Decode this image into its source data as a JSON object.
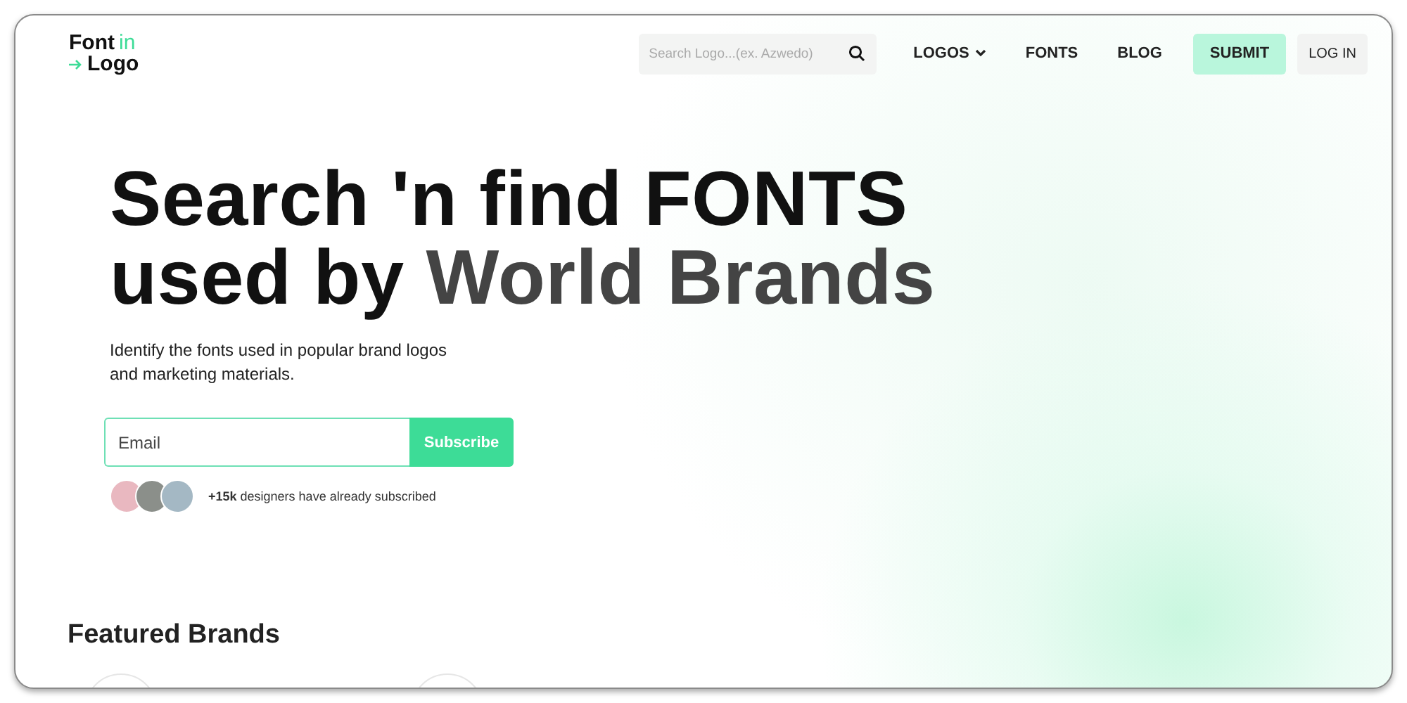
{
  "logo": {
    "word_1": "Font",
    "word_2": "in",
    "word_3": "Logo"
  },
  "search": {
    "placeholder": "Search Logo...(ex. Azwedo)"
  },
  "nav": [
    {
      "label": "LOGOS",
      "kind": "dropdown"
    },
    {
      "label": "FONTS",
      "kind": "link"
    },
    {
      "label": "BLOG",
      "kind": "link"
    },
    {
      "label": "SUBMIT",
      "kind": "primary"
    },
    {
      "label": "LOG IN",
      "kind": "secondary"
    }
  ],
  "hero": {
    "heading_lines": [
      [
        {
          "text": "Search 'n find FONTS",
          "highlight": false
        }
      ],
      [
        {
          "text": "used by ",
          "highlight": false
        },
        {
          "text": "World Brands",
          "highlight": true
        }
      ]
    ],
    "subtitle_lines": [
      "Identify the fonts used in popular brand logos",
      "and marketing materials."
    ],
    "email": {
      "placeholder": "Email"
    },
    "subscribe_button": "Subscribe",
    "social_proof": "**+15k** designers have already subscribed"
  },
  "featured": {
    "title": "Featured Brands"
  }
}
